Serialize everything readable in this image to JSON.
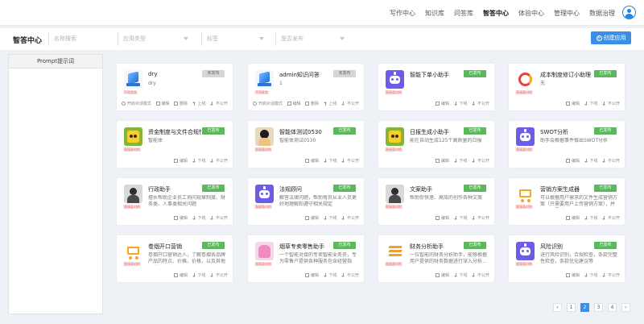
{
  "topnav": {
    "items": [
      {
        "label": "写作中心",
        "active": false
      },
      {
        "label": "知识库",
        "active": false
      },
      {
        "label": "问答库",
        "active": false
      },
      {
        "label": "智答中心",
        "active": true
      },
      {
        "label": "体验中心",
        "active": false
      },
      {
        "label": "管理中心",
        "active": false
      },
      {
        "label": "数据治理",
        "active": false
      }
    ]
  },
  "filterbar": {
    "title": "智答中心",
    "search_placeholder": "名称搜索",
    "type_placeholder": "应用类型",
    "tag_placeholder": "标签",
    "status_placeholder": "是否发布",
    "create_label": "创建应用"
  },
  "sidepanel": {
    "prompt_label": "Prompt提示词"
  },
  "cards": [
    {
      "name": "dry",
      "desc": "dry",
      "tag": "不同状态",
      "status": "未发布",
      "published": false,
      "thumb": "blue-cube",
      "actions": [
        "开启对话模式",
        "编辑",
        "删除",
        "上线",
        "不公开"
      ]
    },
    {
      "name": "admin知识问答",
      "desc": "1",
      "tag": "不同状态",
      "status": "未发布",
      "published": false,
      "thumb": "blue-cube",
      "actions": [
        "开启对话模式",
        "编辑",
        "删除",
        "上线",
        "不公开"
      ]
    },
    {
      "name": "智能下单小助手",
      "desc": "",
      "tag": "直接面对的",
      "status": "已发布",
      "published": true,
      "thumb": "bot",
      "actions": [
        "编辑",
        "下线",
        "不公开"
      ]
    },
    {
      "name": "成本制度修订小助理",
      "desc": "无",
      "tag": "直接面对的",
      "status": "已发布",
      "published": true,
      "thumb": "red-ring",
      "actions": [
        "编辑",
        "下线",
        "不公开"
      ]
    },
    {
      "name": "资金制度与文件合规性审查",
      "desc": "智能体",
      "tag": "直接面对的",
      "status": "已发布",
      "published": true,
      "thumb": "yellow-face",
      "actions": [
        "编辑",
        "下线",
        "不公开"
      ]
    },
    {
      "name": "智能体测试0530",
      "desc": "智能体测试0530",
      "tag": "直接面对的",
      "status": "已发布",
      "published": true,
      "thumb": "anime",
      "actions": [
        "编辑",
        "下线",
        "不公开"
      ]
    },
    {
      "name": "日报生成小助手",
      "desc": "能在自动生成125个高质量的日报",
      "tag": "直接面对的",
      "status": "已发布",
      "published": true,
      "thumb": "yellow-face",
      "actions": [
        "编辑",
        "下线",
        "不公开"
      ]
    },
    {
      "name": "SWOT分析",
      "desc": "助手会根据事件做出SWOT分析",
      "tag": "直接面对的",
      "status": "已发布",
      "published": true,
      "thumb": "bot",
      "actions": [
        "编辑",
        "下线",
        "不公开"
      ]
    },
    {
      "name": "行政助手",
      "desc": "擅长帮助企业员工询问规章制度、财务类、人事类相关问题",
      "tag": "直接面对的",
      "status": "已发布",
      "published": true,
      "thumb": "photo",
      "actions": [
        "编辑",
        "下线",
        "不公开"
      ]
    },
    {
      "name": "法规顾问",
      "desc": "解答法律问题，帮助每员从业人员更好地理解和遵守相关规定",
      "tag": "直接面对的",
      "status": "已发布",
      "published": true,
      "thumb": "bot",
      "actions": [
        "编辑",
        "下线",
        "不公开"
      ]
    },
    {
      "name": "文案助手",
      "desc": "帮助你快速、高效的创作各种文案",
      "tag": "直接面对的",
      "status": "已发布",
      "published": true,
      "thumb": "photo",
      "actions": [
        "编辑",
        "下线",
        "不公开"
      ]
    },
    {
      "name": "营销方案生成器",
      "desc": "可以根据用户需求的文件生成营销方案（只需要用户上传营销方案），并以用户需求…",
      "tag": "直接面对的",
      "status": "已发布",
      "published": true,
      "thumb": "cart",
      "actions": [
        "编辑",
        "下线",
        "不公开"
      ]
    },
    {
      "name": "卷烟开口营销",
      "desc": "卷烟开口营销达人，了解卷烟各品牌产品的特点、价格、价格，以及其他与卷烟…",
      "tag": "直接面对的",
      "status": "已发布",
      "published": true,
      "thumb": "cart",
      "actions": [
        "编辑",
        "下线",
        "不公开"
      ]
    },
    {
      "name": "烟草专卖零售助手",
      "desc": "一个智能对接的专卖智能业务员，专为零售户提供各种服务包含经营指导…",
      "tag": "直接面对的",
      "status": "已发布",
      "published": true,
      "thumb": "pink",
      "actions": [
        "编辑",
        "下线",
        "不公开"
      ]
    },
    {
      "name": "财务分析助手",
      "desc": "一位智能的财务分析助手，能够根据用户提供的财务数据进行深入分析…",
      "tag": "直接面对的",
      "status": "已发布",
      "published": true,
      "thumb": "stripes",
      "actions": [
        "编辑",
        "下线",
        "不公开"
      ]
    },
    {
      "name": "风险识别",
      "desc": "进行风险识别，合规检查，条款完整性检查，条款优化建议等",
      "tag": "直接面对的",
      "status": "已发布",
      "published": true,
      "thumb": "bot",
      "actions": [
        "编辑",
        "下线",
        "不公开"
      ]
    }
  ],
  "pagination": {
    "pages": [
      "1",
      "2",
      "3",
      "4"
    ],
    "current": "2",
    "prev_label": "‹",
    "next_label": "›"
  }
}
